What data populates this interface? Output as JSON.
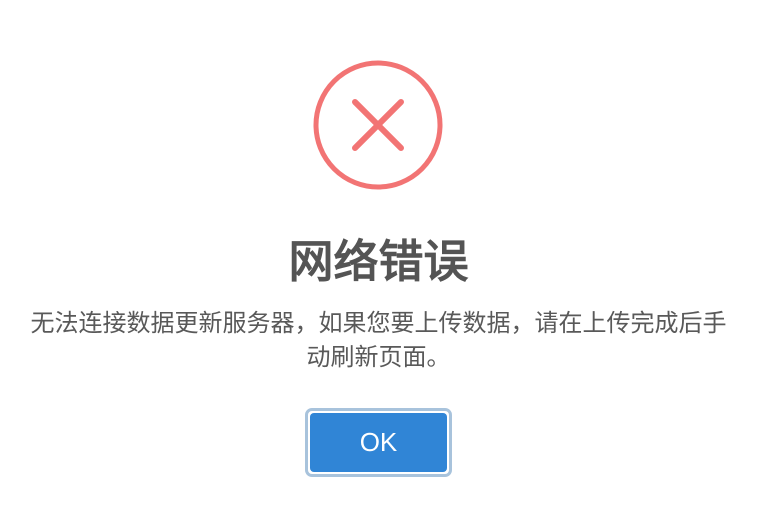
{
  "dialog": {
    "icon": "error-x-icon",
    "icon_color": "#f27474",
    "title": "网络错误",
    "message": "无法连接数据更新服务器，如果您要上传数据，请在上传完成后手动刷新页面。",
    "confirm_label": "OK",
    "confirm_color": "#3085d6"
  }
}
